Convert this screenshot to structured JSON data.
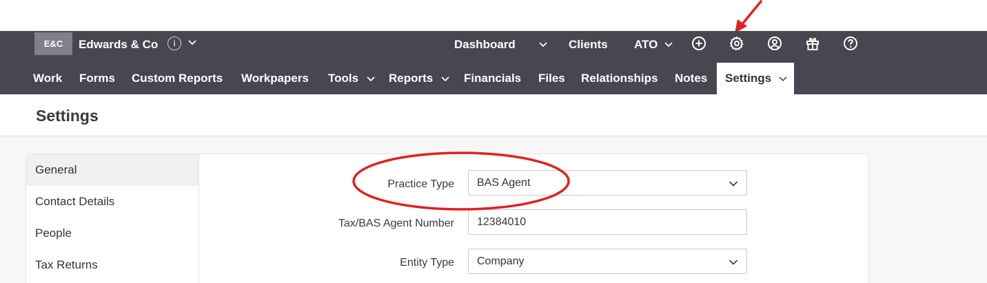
{
  "header": {
    "brand_badge": "E&C",
    "brand_name": "Edwards & Co",
    "brand_info_icon": "info-icon",
    "links": {
      "dashboard": "Dashboard",
      "clients": "Clients",
      "ato": "ATO"
    },
    "icons": [
      "add-icon",
      "gear-icon",
      "user-icon",
      "gift-icon",
      "help-icon"
    ]
  },
  "nav": {
    "items": [
      {
        "label": "Work"
      },
      {
        "label": "Forms"
      },
      {
        "label": "Custom Reports"
      },
      {
        "label": "Workpapers"
      },
      {
        "label": "Tools"
      },
      {
        "label": "Reports"
      },
      {
        "label": "Financials"
      },
      {
        "label": "Files"
      },
      {
        "label": "Relationships"
      },
      {
        "label": "Notes"
      },
      {
        "label": "Settings"
      }
    ]
  },
  "page": {
    "title": "Settings"
  },
  "side_menu": {
    "items": [
      {
        "label": "General"
      },
      {
        "label": "Contact Details"
      },
      {
        "label": "People"
      },
      {
        "label": "Tax Returns"
      }
    ]
  },
  "form": {
    "practice_type": {
      "label": "Practice Type",
      "value": "BAS Agent"
    },
    "agent_number": {
      "label": "Tax/BAS Agent Number",
      "value": "12384010"
    },
    "entity_type": {
      "label": "Entity Type",
      "value": "Company"
    }
  },
  "colors": {
    "topbar": "#474751",
    "badge": "#80808b",
    "annotation": "#e02020"
  }
}
